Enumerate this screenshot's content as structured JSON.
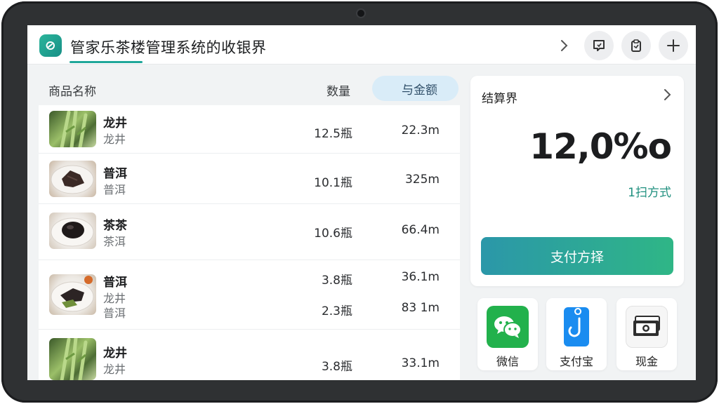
{
  "header": {
    "title": "管家乐茶楼管理系统的收银界"
  },
  "list": {
    "columns": {
      "name": "商品名称",
      "qty": "数量",
      "amount": "与金额"
    },
    "rows": [
      {
        "name": "龙井",
        "sub": "龙井",
        "qty": "12.5瓶",
        "amount": "22.3m",
        "thumb": "tea-leaves"
      },
      {
        "name": "普洱",
        "sub": "普洱",
        "qty": "10.1瓶",
        "amount": "325m",
        "thumb": "dark-tea-plate"
      },
      {
        "name": "茶茶",
        "sub": "茶洱",
        "qty": "10.6瓶",
        "amount": "66.4m",
        "thumb": "tea-cake-plate"
      },
      {
        "name": "普洱",
        "sub": "龙井",
        "sub2": "普洱",
        "qty": "3.8瓶",
        "amount": "36.1m",
        "qty2": "2.3瓶",
        "amount2": "83 1m",
        "thumb": "mixed-plate"
      },
      {
        "name": "龙井",
        "sub": "龙井",
        "qty": "3.8瓶",
        "amount": "33.1m",
        "thumb": "tea-leaves"
      }
    ]
  },
  "checkout": {
    "title": "结算界",
    "total": "12,0%o",
    "pay_count": "1扫方式",
    "pay_button": "支付方择"
  },
  "methods": [
    {
      "label": "微信",
      "icon": "wechat-icon",
      "color": "#22b14c"
    },
    {
      "label": "支付宝",
      "icon": "alipay-icon",
      "color": "#1a8cf0"
    },
    {
      "label": "现金",
      "icon": "cash-icon",
      "color": "#2e2e2e"
    }
  ]
}
